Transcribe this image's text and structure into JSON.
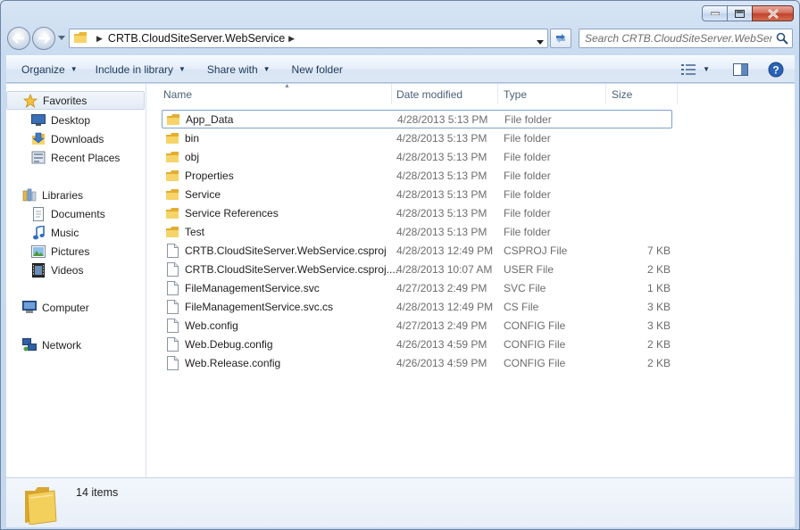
{
  "window": {
    "caption_buttons": [
      "minimize",
      "maximize",
      "close"
    ]
  },
  "address": {
    "path_segment": "CRTB.CloudSiteServer.WebService"
  },
  "search": {
    "placeholder": "Search CRTB.CloudSiteServer.WebServ..."
  },
  "toolbar": {
    "organize": "Organize",
    "include_in_library": "Include in library",
    "share_with": "Share with",
    "new_folder": "New folder"
  },
  "nav": {
    "favorites": "Favorites",
    "desktop": "Desktop",
    "downloads": "Downloads",
    "recent_places": "Recent Places",
    "libraries": "Libraries",
    "documents": "Documents",
    "music": "Music",
    "pictures": "Pictures",
    "videos": "Videos",
    "computer": "Computer",
    "network": "Network"
  },
  "columns": {
    "name": "Name",
    "date_modified": "Date modified",
    "type": "Type",
    "size": "Size"
  },
  "files": [
    {
      "name": "App_Data",
      "date": "4/28/2013 5:13 PM",
      "type": "File folder",
      "size": "",
      "icon": "folder-icon"
    },
    {
      "name": "bin",
      "date": "4/28/2013 5:13 PM",
      "type": "File folder",
      "size": "",
      "icon": "folder-icon"
    },
    {
      "name": "obj",
      "date": "4/28/2013 5:13 PM",
      "type": "File folder",
      "size": "",
      "icon": "folder-icon"
    },
    {
      "name": "Properties",
      "date": "4/28/2013 5:13 PM",
      "type": "File folder",
      "size": "",
      "icon": "folder-icon"
    },
    {
      "name": "Service",
      "date": "4/28/2013 5:13 PM",
      "type": "File folder",
      "size": "",
      "icon": "folder-icon"
    },
    {
      "name": "Service References",
      "date": "4/28/2013 5:13 PM",
      "type": "File folder",
      "size": "",
      "icon": "folder-icon"
    },
    {
      "name": "Test",
      "date": "4/28/2013 5:13 PM",
      "type": "File folder",
      "size": "",
      "icon": "folder-icon"
    },
    {
      "name": "CRTB.CloudSiteServer.WebService.csproj",
      "date": "4/28/2013 12:49 PM",
      "type": "CSPROJ File",
      "size": "7 KB",
      "icon": "file-icon"
    },
    {
      "name": "CRTB.CloudSiteServer.WebService.csproj....",
      "date": "4/28/2013 10:07 AM",
      "type": "USER File",
      "size": "2 KB",
      "icon": "file-icon"
    },
    {
      "name": "FileManagementService.svc",
      "date": "4/27/2013 2:49 PM",
      "type": "SVC File",
      "size": "1 KB",
      "icon": "file-icon"
    },
    {
      "name": "FileManagementService.svc.cs",
      "date": "4/28/2013 12:49 PM",
      "type": "CS File",
      "size": "3 KB",
      "icon": "file-icon"
    },
    {
      "name": "Web.config",
      "date": "4/27/2013 2:49 PM",
      "type": "CONFIG File",
      "size": "3 KB",
      "icon": "file-icon"
    },
    {
      "name": "Web.Debug.config",
      "date": "4/26/2013 4:59 PM",
      "type": "CONFIG File",
      "size": "2 KB",
      "icon": "file-icon"
    },
    {
      "name": "Web.Release.config",
      "date": "4/26/2013 4:59 PM",
      "type": "CONFIG File",
      "size": "2 KB",
      "icon": "file-icon"
    }
  ],
  "details": {
    "item_count": "14 items"
  },
  "colors": {
    "folder_yellow": "#f1c84b",
    "selection_border": "#7da2ce",
    "toolbar_text": "#1e395b"
  }
}
